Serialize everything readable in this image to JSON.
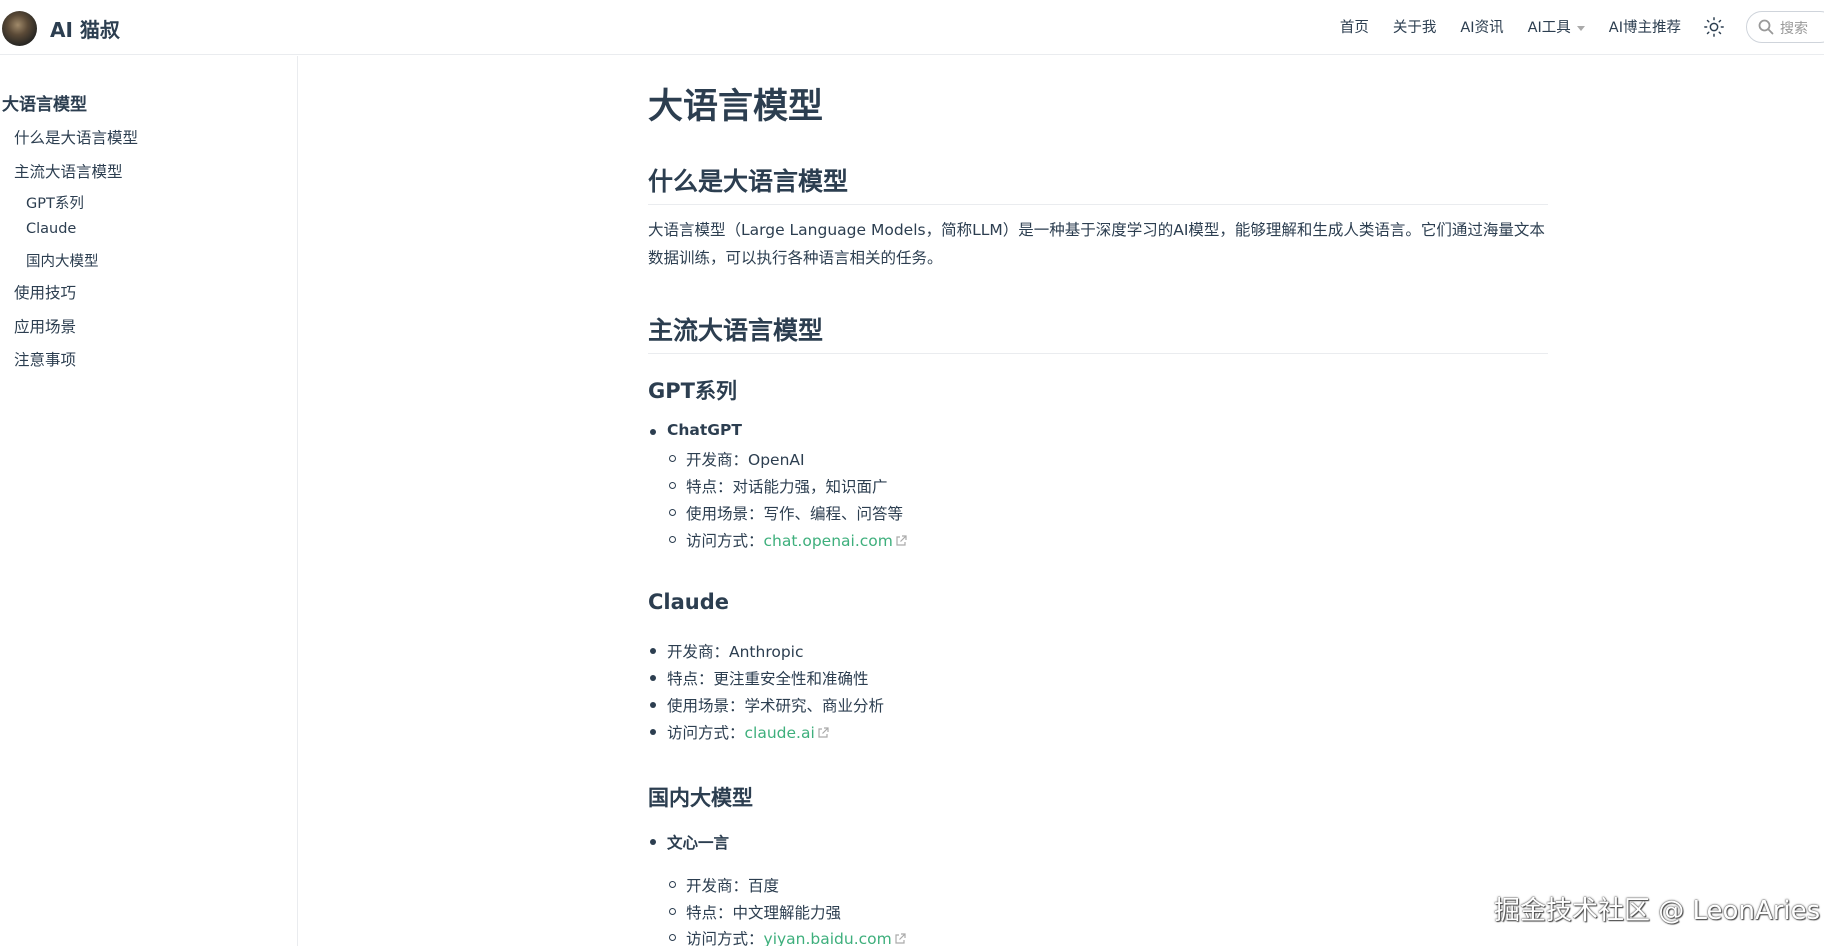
{
  "header": {
    "site_title": "AI 猫叔",
    "nav": [
      "首页",
      "关于我",
      "AI资讯",
      "AI工具",
      "AI博主推荐"
    ],
    "search_placeholder": "搜索"
  },
  "sidebar": {
    "heading": "大语言模型",
    "items": [
      {
        "label": "什么是大语言模型"
      },
      {
        "label": "主流大语言模型"
      },
      {
        "label": "GPT系列"
      },
      {
        "label": "Claude"
      },
      {
        "label": "国内大模型"
      },
      {
        "label": "使用技巧"
      },
      {
        "label": "应用场景"
      },
      {
        "label": "注意事项"
      }
    ]
  },
  "main": {
    "title": "大语言模型",
    "sections": {
      "what_is": {
        "heading": "什么是大语言模型",
        "paragraph": "大语言模型（Large Language Models，简称LLM）是一种基于深度学习的AI模型，能够理解和生成人类语言。它们通过海量文本数据训练，可以执行各种语言相关的任务。"
      },
      "mainstream": {
        "heading": "主流大语言模型"
      },
      "gpt": {
        "heading": "GPT系列",
        "item": "ChatGPT",
        "developer": "开发商：OpenAI",
        "features": "特点：对话能力强，知识面广",
        "scenarios": "使用场景：写作、编程、问答等",
        "access_label": "访问方式：",
        "access_link": "chat.openai.com"
      },
      "claude": {
        "heading": "Claude",
        "developer": "开发商：Anthropic",
        "features": "特点：更注重安全性和准确性",
        "scenarios": "使用场景：学术研究、商业分析",
        "access_label": "访问方式：",
        "access_link": "claude.ai"
      },
      "domestic": {
        "heading": "国内大模型",
        "item": "文心一言",
        "developer": "开发商：百度",
        "features": "特点：中文理解能力强",
        "access_label": "访问方式：",
        "access_link": "yiyan.baidu.com"
      }
    }
  },
  "watermark": "掘金技术社区 @ LeonAries",
  "colors": {
    "text": "#2c3e50",
    "link": "#3eaf7c",
    "border": "#eaecef"
  }
}
